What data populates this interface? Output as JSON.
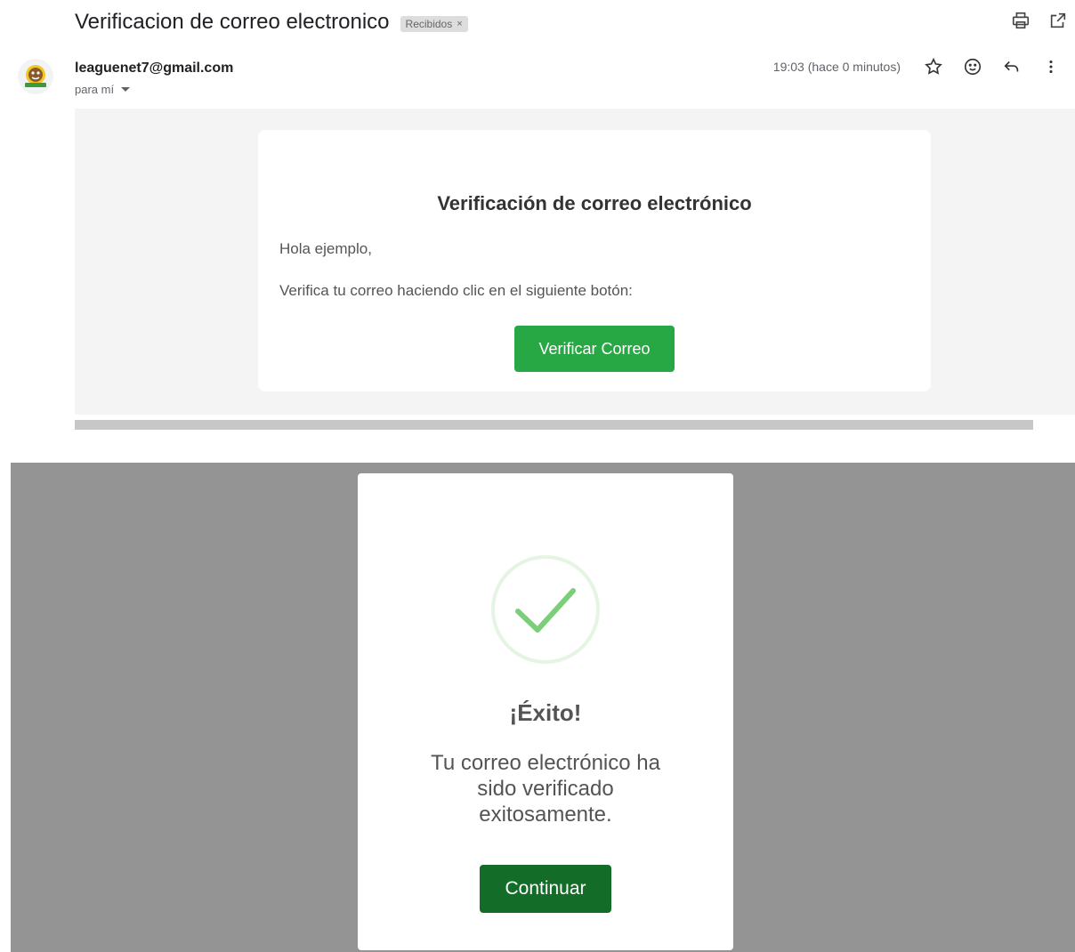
{
  "email": {
    "subject": "Verificacion de correo electronico",
    "label_chip": "Recibidos",
    "label_remove": "×",
    "sender": "leaguenet7@gmail.com",
    "to_line": "para mí",
    "time": "19:03 (hace 0 minutos)",
    "icons": [
      "print-icon",
      "open-in-new-window-icon",
      "star-icon",
      "emoji-icon",
      "reply-icon",
      "more-vert-icon"
    ],
    "body": {
      "title": "Verificación de correo electrónico",
      "greeting": "Hola ejemplo,",
      "text": "Verifica tu correo haciendo clic en el siguiente botón:",
      "button_label": "Verificar Correo"
    }
  },
  "modal": {
    "title": "¡Éxito!",
    "message": "Tu correo electrónico ha sido verificado exitosamente.",
    "button_label": "Continuar",
    "icon": "check-circle-icon"
  },
  "colors": {
    "verify_button": "#28a745",
    "continue_button": "#146c29",
    "success_check": "#7ccf7a",
    "overlay": "#949494"
  }
}
